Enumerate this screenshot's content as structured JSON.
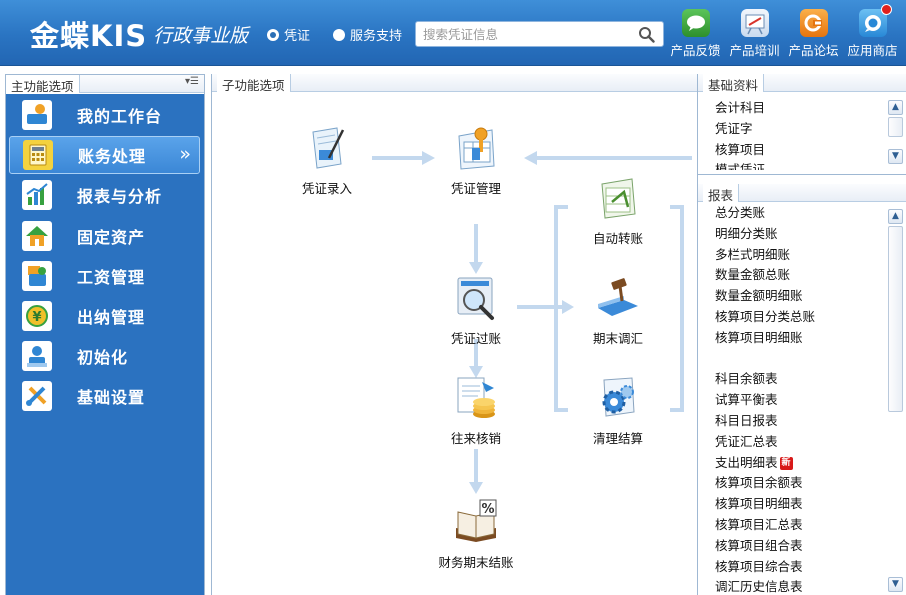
{
  "header": {
    "brand": "金蝶KIS",
    "edition": "行政事业版",
    "radio_voucher": "凭证",
    "radio_service": "服务支持",
    "search_placeholder": "搜索凭证信息",
    "tools": [
      {
        "label": "产品反馈",
        "icon": "chat-bubble-icon",
        "color": "#3aa43a"
      },
      {
        "label": "产品培训",
        "icon": "training-board-icon",
        "color": "#d9e7f7"
      },
      {
        "label": "产品论坛",
        "icon": "forum-icon",
        "color": "#ef8a1a"
      },
      {
        "label": "应用商店",
        "icon": "app-store-icon",
        "color": "#3aa0e6"
      }
    ]
  },
  "left_panel": {
    "tab": "主功能选项",
    "items": [
      {
        "label": "我的工作台",
        "icon": "workbench-icon"
      },
      {
        "label": "账务处理",
        "icon": "accounting-icon",
        "active": true
      },
      {
        "label": "报表与分析",
        "icon": "report-chart-icon"
      },
      {
        "label": "固定资产",
        "icon": "fixed-asset-icon"
      },
      {
        "label": "工资管理",
        "icon": "payroll-icon"
      },
      {
        "label": "出纳管理",
        "icon": "cashier-icon"
      },
      {
        "label": "初始化",
        "icon": "initialize-icon"
      },
      {
        "label": "基础设置",
        "icon": "settings-tools-icon"
      }
    ]
  },
  "center_panel": {
    "tab": "子功能选项",
    "functions": {
      "voucher_entry": "凭证录入",
      "voucher_manage": "凭证管理",
      "auto_transfer": "自动转账",
      "voucher_post": "凭证过账",
      "period_adjust": "期末调汇",
      "ar_ap_writeoff": "往来核销",
      "clear_settle": "清理结算",
      "period_close": "财务期末结账"
    }
  },
  "right_panel": {
    "basic_tab": "基础资料",
    "basic_items": [
      "会计科目",
      "凭证字",
      "核算项目",
      "模式凭证"
    ],
    "report_tab": "报表",
    "report_items_a": [
      "总分类账",
      "明细分类账",
      "多栏式明细账",
      "数量金额总账",
      "数量金额明细账",
      "核算项目分类总账",
      "核算项目明细账"
    ],
    "report_items_b": [
      "科目余额表",
      "试算平衡表",
      "科目日报表",
      "凭证汇总表"
    ],
    "new_item": "支出明细表",
    "new_badge": "新",
    "report_items_c": [
      "核算项目余额表",
      "核算项目明细表",
      "核算项目汇总表",
      "核算项目组合表",
      "核算项目综合表",
      "调汇历史信息表"
    ]
  }
}
